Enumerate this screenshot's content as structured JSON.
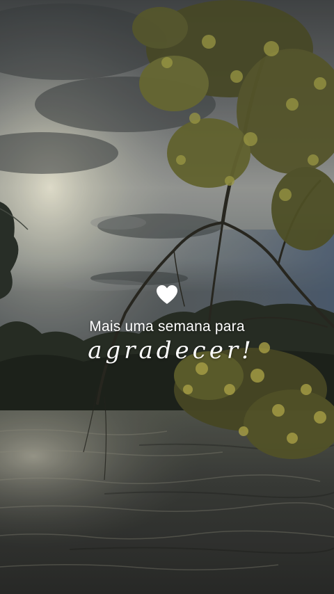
{
  "overlay": {
    "heart_icon": "heart-icon",
    "line1": "Mais uma semana para",
    "line2": "agradecer!"
  },
  "colors": {
    "text": "#ffffff",
    "sky_top": "#4a4e50",
    "sky_glow": "#dcdcc6",
    "water": "#3c3e3c",
    "foliage": "#8a8a3a"
  }
}
